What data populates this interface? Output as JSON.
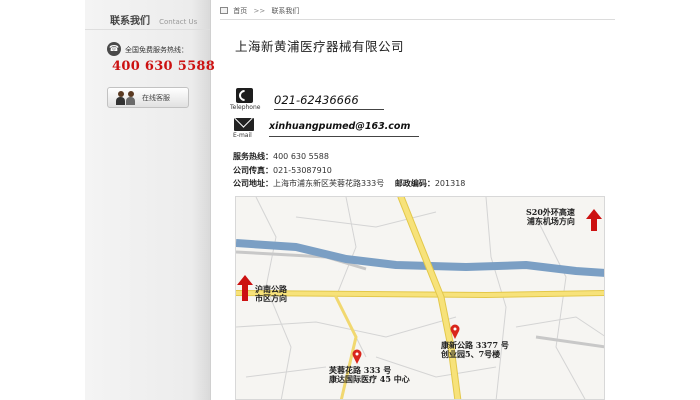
{
  "sidebar": {
    "title": "联系我们",
    "title_en": "Contact Us",
    "hotline_label": "全国免费服务热线：",
    "hotline_number": "400 630 5588",
    "online_service_label": "在线客服"
  },
  "breadcrumb": {
    "home": "首页",
    "separator": ">>",
    "current": "联系我们"
  },
  "company_name": "上海新黄浦医疗器械有限公司",
  "contact": {
    "telephone_caption": "Telephone",
    "telephone": "021-62436666",
    "email_caption": "E-mail",
    "email": "xinhuangpumed@163.com"
  },
  "info": {
    "service_label": "服务热线：",
    "service_value": "400 630 5588",
    "fax_label": "公司传真：",
    "fax_value": "021-53087910",
    "address_label": "公司地址：",
    "address_value": "上海市浦东新区芙蓉花路333号",
    "postcode_label": "邮政编码：",
    "postcode_value": "201318"
  },
  "map": {
    "annotation_ne_1": "S20外环高速",
    "annotation_ne_2": "浦东机场方向",
    "annotation_w_1": "沪南公路",
    "annotation_w_2": "市区方向",
    "marker1_line1": "康新公路 3377 号",
    "marker1_line2": "创业园5、7号楼",
    "marker2_line1": "芙蓉花路 333 号",
    "marker2_line2": "康达国际医疗 45 中心"
  },
  "colors": {
    "accent_red": "#cc1111",
    "road_yellow": "#f2dc6a",
    "river_blue": "#7b9fc4"
  }
}
